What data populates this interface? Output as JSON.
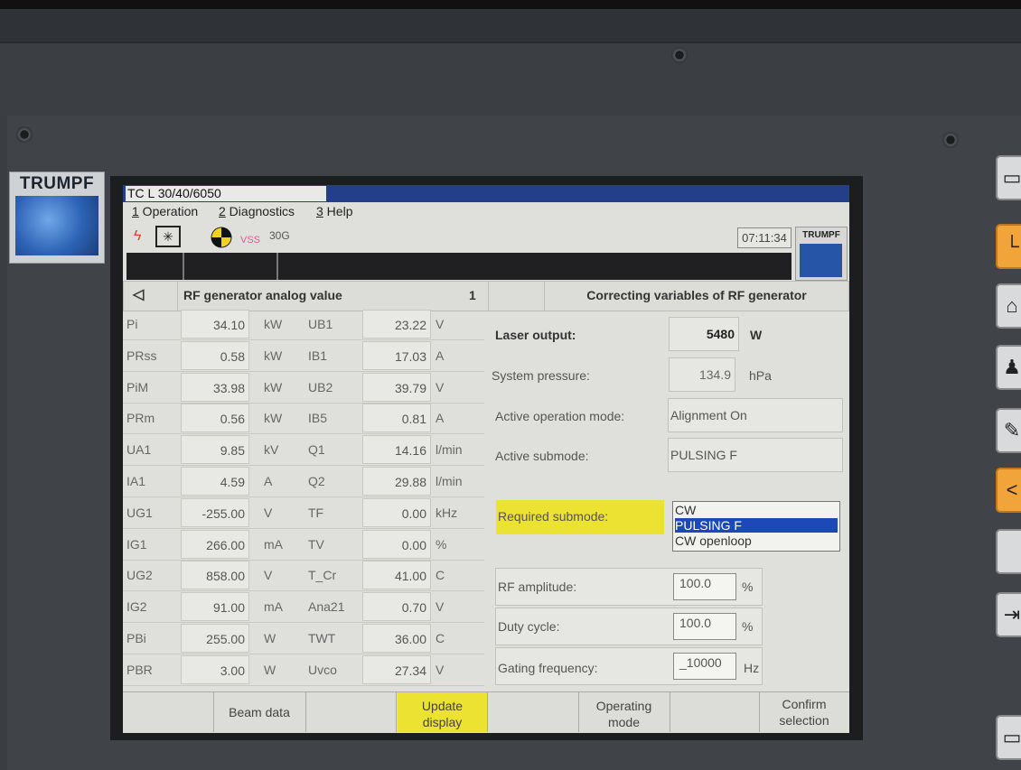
{
  "brand": {
    "logo_text": "TRUMPF"
  },
  "window": {
    "title": "TC L 30/40/6050"
  },
  "menu": {
    "items": [
      "1 Operation",
      "2 Diagnostics",
      "3 Help"
    ]
  },
  "toolbar": {
    "status_text": "VSS",
    "code": "30G",
    "clock": "07:11:34",
    "logo_text": "TRUMPF"
  },
  "left_panel": {
    "title": "RF generator analog value",
    "page": "1",
    "rows": [
      {
        "name": "Pi",
        "value": "34.10",
        "unit": "kW",
        "name2": "UB1",
        "value2": "23.22",
        "unit2": "V"
      },
      {
        "name": "PRss",
        "value": "0.58",
        "unit": "kW",
        "name2": "IB1",
        "value2": "17.03",
        "unit2": "A"
      },
      {
        "name": "PiM",
        "value": "33.98",
        "unit": "kW",
        "name2": "UB2",
        "value2": "39.79",
        "unit2": "V"
      },
      {
        "name": "PRm",
        "value": "0.56",
        "unit": "kW",
        "name2": "IB5",
        "value2": "0.81",
        "unit2": "A"
      },
      {
        "name": "UA1",
        "value": "9.85",
        "unit": "kV",
        "name2": "Q1",
        "value2": "14.16",
        "unit2": "l/min"
      },
      {
        "name": "IA1",
        "value": "4.59",
        "unit": "A",
        "name2": "Q2",
        "value2": "29.88",
        "unit2": "l/min"
      },
      {
        "name": "UG1",
        "value": "-255.00",
        "unit": "V",
        "name2": "TF",
        "value2": "0.00",
        "unit2": "kHz"
      },
      {
        "name": "IG1",
        "value": "266.00",
        "unit": "mA",
        "name2": "TV",
        "value2": "0.00",
        "unit2": "%"
      },
      {
        "name": "UG2",
        "value": "858.00",
        "unit": "V",
        "name2": "T_Cr",
        "value2": "41.00",
        "unit2": "C"
      },
      {
        "name": "IG2",
        "value": "91.00",
        "unit": "mA",
        "name2": "Ana21",
        "value2": "0.70",
        "unit2": "V"
      },
      {
        "name": "PBi",
        "value": "255.00",
        "unit": "W",
        "name2": "TWT",
        "value2": "36.00",
        "unit2": "C"
      },
      {
        "name": "PBR",
        "value": "3.00",
        "unit": "W",
        "name2": "Uvco",
        "value2": "27.34",
        "unit2": "V"
      }
    ]
  },
  "right_panel": {
    "title": "Correcting variables of RF generator",
    "laser_output": {
      "label": "Laser output:",
      "value": "5480",
      "unit": "W"
    },
    "system_pressure": {
      "label": "System pressure:",
      "value": "134.9",
      "unit": "hPa"
    },
    "active_operation_mode": {
      "label": "Active operation mode:",
      "value": "Alignment On"
    },
    "active_submode": {
      "label": "Active submode:",
      "value": "PULSING  F"
    },
    "required_submode": {
      "label": "Required submode:",
      "options": [
        "CW",
        "PULSING  F",
        "CW openloop"
      ],
      "selected": "PULSING  F"
    },
    "rf_amplitude": {
      "label": "RF amplitude:",
      "value": "100.0",
      "unit": "%"
    },
    "duty_cycle": {
      "label": "Duty cycle:",
      "value": "100.0",
      "unit": "%"
    },
    "gating_frequency": {
      "label": "Gating frequency:",
      "value": "_10000",
      "unit": "Hz"
    }
  },
  "softkeys": [
    {
      "label": "Beam data"
    },
    {
      "label": "Update display",
      "highlight": "#ece232"
    },
    {
      "label": "Operating mode"
    },
    {
      "label": "Confirm selection"
    }
  ],
  "colors": {
    "titlebar": "#233f8a",
    "selection": "#1c48b8",
    "highlight": "#ece232"
  }
}
